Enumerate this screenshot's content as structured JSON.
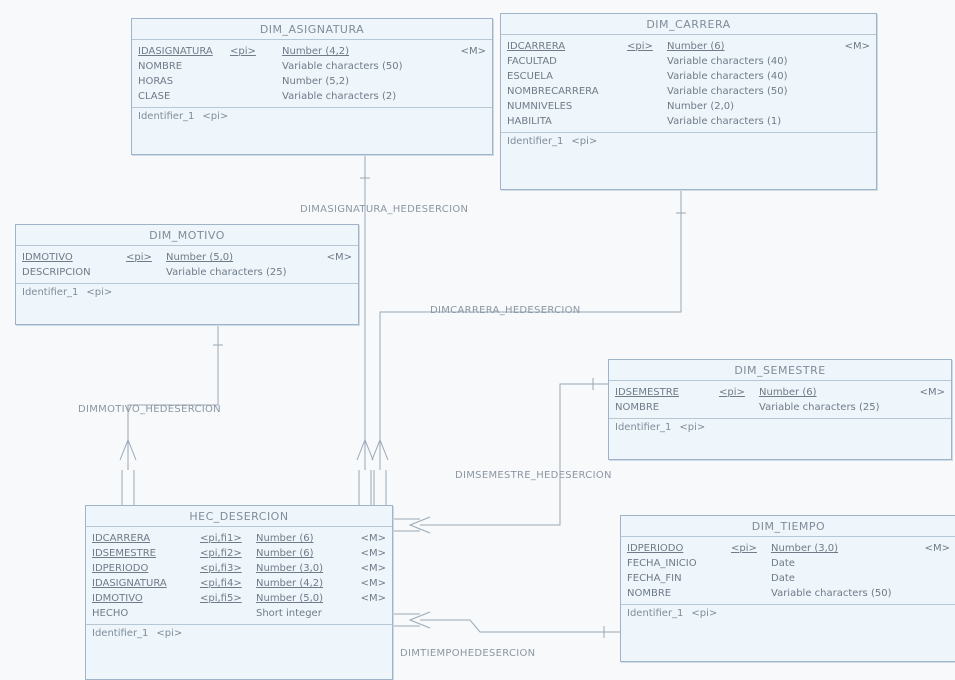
{
  "entities": {
    "dim_asignatura": {
      "title": "DIM_ASIGNATURA",
      "attributes": [
        {
          "name": "IDASIGNATURA",
          "key": "<pi>",
          "type": "Number (4,2)",
          "flag": "<M>",
          "pk": true
        },
        {
          "name": "NOMBRE",
          "key": "",
          "type": "Variable characters (50)",
          "flag": "",
          "pk": false
        },
        {
          "name": "HORAS",
          "key": "",
          "type": "Number (5,2)",
          "flag": "",
          "pk": false
        },
        {
          "name": "CLASE",
          "key": "",
          "type": "Variable characters (2)",
          "flag": "",
          "pk": false
        }
      ],
      "identifier": {
        "name": "Identifier_1",
        "tag": "<pi>"
      }
    },
    "dim_carrera": {
      "title": "DIM_CARRERA",
      "attributes": [
        {
          "name": "IDCARRERA",
          "key": "<pi>",
          "type": "Number (6)",
          "flag": "<M>",
          "pk": true
        },
        {
          "name": "FACULTAD",
          "key": "",
          "type": "Variable characters (40)",
          "flag": "",
          "pk": false
        },
        {
          "name": "ESCUELA",
          "key": "",
          "type": "Variable characters (40)",
          "flag": "",
          "pk": false
        },
        {
          "name": "NOMBRECARRERA",
          "key": "",
          "type": "Variable characters (50)",
          "flag": "",
          "pk": false
        },
        {
          "name": "NUMNIVELES",
          "key": "",
          "type": "Number (2,0)",
          "flag": "",
          "pk": false
        },
        {
          "name": "HABILITA",
          "key": "",
          "type": "Variable characters (1)",
          "flag": "",
          "pk": false
        }
      ],
      "identifier": {
        "name": "Identifier_1",
        "tag": "<pi>"
      }
    },
    "dim_motivo": {
      "title": "DIM_MOTIVO",
      "attributes": [
        {
          "name": "IDMOTIVO",
          "key": "<pi>",
          "type": "Number (5,0)",
          "flag": "<M>",
          "pk": true
        },
        {
          "name": "DESCRIPCION",
          "key": "",
          "type": "Variable characters (25)",
          "flag": "",
          "pk": false
        }
      ],
      "identifier": {
        "name": "Identifier_1",
        "tag": "<pi>"
      }
    },
    "dim_semestre": {
      "title": "DIM_SEMESTRE",
      "attributes": [
        {
          "name": "IDSEMESTRE",
          "key": "<pi>",
          "type": "Number (6)",
          "flag": "<M>",
          "pk": true
        },
        {
          "name": "NOMBRE",
          "key": "",
          "type": "Variable characters (25)",
          "flag": "",
          "pk": false
        }
      ],
      "identifier": {
        "name": "Identifier_1",
        "tag": "<pi>"
      }
    },
    "hec_desercion": {
      "title": "HEC_DESERCION",
      "attributes": [
        {
          "name": "IDCARRERA",
          "key": "<pi,fi1>",
          "type": "Number (6)",
          "flag": "<M>",
          "pk": true
        },
        {
          "name": "IDSEMESTRE",
          "key": "<pi,fi2>",
          "type": "Number (6)",
          "flag": "<M>",
          "pk": true
        },
        {
          "name": "IDPERIODO",
          "key": "<pi,fi3>",
          "type": "Number (3,0)",
          "flag": "<M>",
          "pk": true
        },
        {
          "name": "IDASIGNATURA",
          "key": "<pi,fi4>",
          "type": "Number (4,2)",
          "flag": "<M>",
          "pk": true
        },
        {
          "name": "IDMOTIVO",
          "key": "<pi,fi5>",
          "type": "Number (5,0)",
          "flag": "<M>",
          "pk": true
        },
        {
          "name": "HECHO",
          "key": "",
          "type": "Short integer",
          "flag": "",
          "pk": false
        }
      ],
      "identifier": {
        "name": "Identifier_1",
        "tag": "<pi>"
      }
    },
    "dim_tiempo": {
      "title": "DIM_TIEMPO",
      "attributes": [
        {
          "name": "IDPERIODO",
          "key": "<pi>",
          "type": "Number (3,0)",
          "flag": "<M>",
          "pk": true
        },
        {
          "name": "FECHA_INICIO",
          "key": "",
          "type": "Date",
          "flag": "",
          "pk": false
        },
        {
          "name": "FECHA_FIN",
          "key": "",
          "type": "Date",
          "flag": "",
          "pk": false
        },
        {
          "name": "NOMBRE",
          "key": "",
          "type": "Variable characters (50)",
          "flag": "",
          "pk": false
        }
      ],
      "identifier": {
        "name": "Identifier_1",
        "tag": "<pi>"
      }
    }
  },
  "relationships": {
    "asignatura": "DIMASIGNATURA_HEDESERCION",
    "carrera": "DIMCARRERA_HEDESERCION",
    "motivo": "DIMMOTIVO_HEDESERCION",
    "semestre": "DIMSEMESTRE_HEDESERCION",
    "tiempo": "DIMTIEMPOHEDESERCION"
  }
}
